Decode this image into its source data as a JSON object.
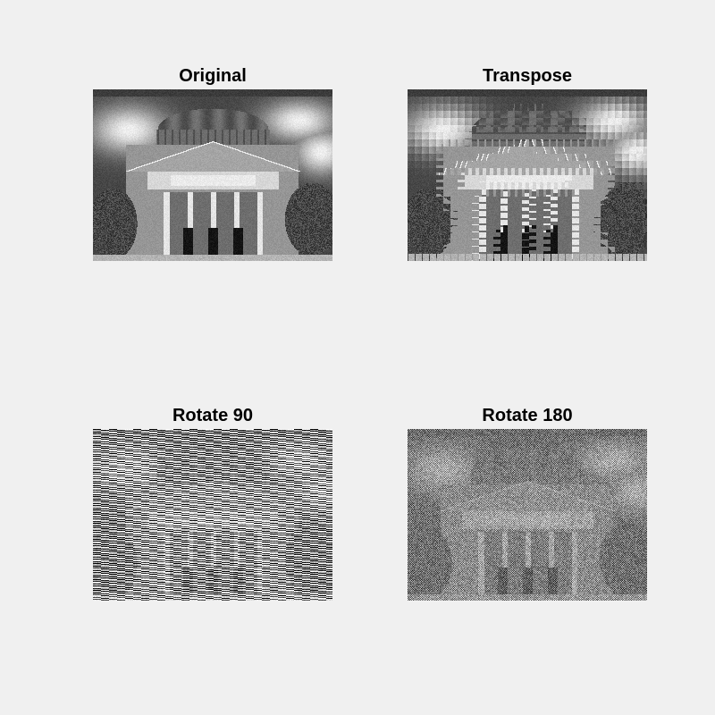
{
  "figure": {
    "background": "#f0f0f0",
    "subplots": [
      {
        "title": "Original",
        "pattern": "building-photo"
      },
      {
        "title": "Transpose",
        "pattern": "block-transposed"
      },
      {
        "title": "Rotate 90",
        "pattern": "horizontal-stripes"
      },
      {
        "title": "Rotate 180",
        "pattern": "checker-noise"
      }
    ]
  }
}
